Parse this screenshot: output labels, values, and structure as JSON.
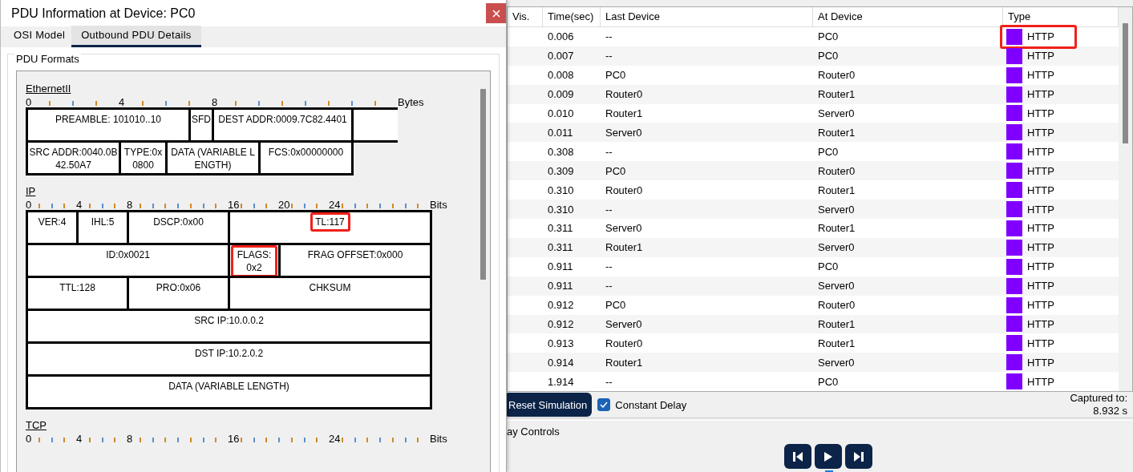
{
  "dialog": {
    "title": "PDU Information at Device: PC0",
    "tabs": [
      {
        "label": "OSI Model",
        "selected": false
      },
      {
        "label": "Outbound PDU Details",
        "selected": true
      }
    ],
    "group_title": "PDU Formats",
    "formats": [
      {
        "name": "EthernetII",
        "unit": "Bytes",
        "ruler": [
          "0",
          "4",
          "8"
        ],
        "rows": [
          {
            "fields": [
              {
                "label": "PREAMBLE: 101010..10",
                "highlighted": false
              },
              {
                "label": "SFD",
                "highlighted": false
              },
              {
                "label": "DEST ADDR:0009.7C82.4401",
                "highlighted": false
              }
            ]
          },
          {
            "fields": [
              {
                "label": "SRC ADDR:0040.0B42.50A7",
                "highlighted": false
              },
              {
                "label": "TYPE:0x0800",
                "highlighted": false
              },
              {
                "label": "DATA (VARIABLE LENGTH)",
                "highlighted": false
              },
              {
                "label": "FCS:0x00000000",
                "highlighted": false
              }
            ]
          }
        ]
      },
      {
        "name": "IP",
        "unit": "Bits",
        "ruler": [
          "0",
          "4",
          "8",
          "16",
          "20",
          "24"
        ],
        "rows": [
          {
            "fields": [
              {
                "label": "VER:4",
                "highlighted": false
              },
              {
                "label": "IHL:5",
                "highlighted": false
              },
              {
                "label": "DSCP:0x00",
                "highlighted": false
              },
              {
                "label": "TL:117",
                "highlighted": true
              }
            ]
          },
          {
            "fields": [
              {
                "label": "ID:0x0021",
                "highlighted": false
              },
              {
                "label": "FLAGS: 0x2",
                "highlighted": true
              },
              {
                "label": "FRAG OFFSET:0x000",
                "highlighted": false
              }
            ]
          },
          {
            "fields": [
              {
                "label": "TTL:128",
                "highlighted": false
              },
              {
                "label": "PRO:0x06",
                "highlighted": false
              },
              {
                "label": "CHKSUM",
                "highlighted": false
              }
            ]
          },
          {
            "fields": [
              {
                "label": "SRC IP:10.0.0.2",
                "highlighted": false
              }
            ]
          },
          {
            "fields": [
              {
                "label": "DST IP:10.2.0.2",
                "highlighted": false
              }
            ]
          },
          {
            "fields": [
              {
                "label": "DATA (VARIABLE LENGTH)",
                "highlighted": false
              }
            ]
          }
        ]
      },
      {
        "name": "TCP",
        "unit": "Bits",
        "ruler": [
          "0",
          "4",
          "8",
          "16",
          "24"
        ]
      }
    ]
  },
  "event_list": {
    "columns": [
      "Vis.",
      "Time(sec)",
      "Last Device",
      "At Device",
      "Type"
    ],
    "rows": [
      {
        "time": "0.006",
        "last_device": "--",
        "at_device": "PC0",
        "type": "HTTP",
        "color": "#8000ff",
        "highlighted": true
      },
      {
        "time": "0.007",
        "last_device": "--",
        "at_device": "PC0",
        "type": "HTTP",
        "color": "#8000ff",
        "highlighted": false
      },
      {
        "time": "0.008",
        "last_device": "PC0",
        "at_device": "Router0",
        "type": "HTTP",
        "color": "#8000ff",
        "highlighted": false
      },
      {
        "time": "0.009",
        "last_device": "Router0",
        "at_device": "Router1",
        "type": "HTTP",
        "color": "#8000ff",
        "highlighted": false
      },
      {
        "time": "0.010",
        "last_device": "Router1",
        "at_device": "Server0",
        "type": "HTTP",
        "color": "#8000ff",
        "highlighted": false
      },
      {
        "time": "0.011",
        "last_device": "Server0",
        "at_device": "Router1",
        "type": "HTTP",
        "color": "#8000ff",
        "highlighted": false
      },
      {
        "time": "0.308",
        "last_device": "--",
        "at_device": "PC0",
        "type": "HTTP",
        "color": "#8000ff",
        "highlighted": false
      },
      {
        "time": "0.309",
        "last_device": "PC0",
        "at_device": "Router0",
        "type": "HTTP",
        "color": "#8000ff",
        "highlighted": false
      },
      {
        "time": "0.310",
        "last_device": "Router0",
        "at_device": "Router1",
        "type": "HTTP",
        "color": "#8000ff",
        "highlighted": false
      },
      {
        "time": "0.310",
        "last_device": "--",
        "at_device": "Server0",
        "type": "HTTP",
        "color": "#8000ff",
        "highlighted": false
      },
      {
        "time": "0.311",
        "last_device": "Server0",
        "at_device": "Router1",
        "type": "HTTP",
        "color": "#8000ff",
        "highlighted": false
      },
      {
        "time": "0.311",
        "last_device": "Router1",
        "at_device": "Server0",
        "type": "HTTP",
        "color": "#8000ff",
        "highlighted": false
      },
      {
        "time": "0.911",
        "last_device": "--",
        "at_device": "PC0",
        "type": "HTTP",
        "color": "#8000ff",
        "highlighted": false
      },
      {
        "time": "0.911",
        "last_device": "--",
        "at_device": "Server0",
        "type": "HTTP",
        "color": "#8000ff",
        "highlighted": false
      },
      {
        "time": "0.912",
        "last_device": "PC0",
        "at_device": "Router0",
        "type": "HTTP",
        "color": "#8000ff",
        "highlighted": false
      },
      {
        "time": "0.912",
        "last_device": "Server0",
        "at_device": "Router1",
        "type": "HTTP",
        "color": "#8000ff",
        "highlighted": false
      },
      {
        "time": "0.913",
        "last_device": "Router0",
        "at_device": "Router1",
        "type": "HTTP",
        "color": "#8000ff",
        "highlighted": false
      },
      {
        "time": "0.914",
        "last_device": "Router1",
        "at_device": "Server0",
        "type": "HTTP",
        "color": "#8000ff",
        "highlighted": false
      },
      {
        "time": "1.914",
        "last_device": "--",
        "at_device": "PC0",
        "type": "HTTP",
        "color": "#8000ff",
        "highlighted": false
      }
    ]
  },
  "controls": {
    "reset_button": "Reset Simulation",
    "constant_delay": {
      "label": "Constant Delay",
      "checked": true
    },
    "captured_label": "Captured to:",
    "captured_value": "8.932 s",
    "play_controls_title": "ay Controls"
  }
}
